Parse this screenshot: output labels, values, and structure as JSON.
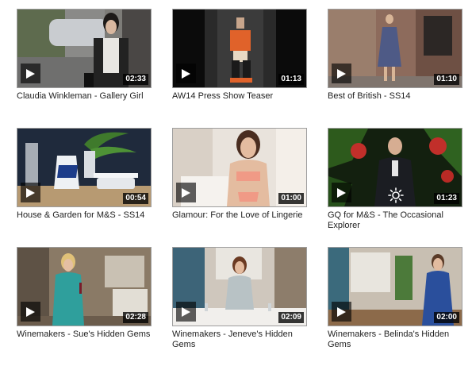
{
  "videos": [
    {
      "title": "Claudia Winkleman - Gallery Girl",
      "duration": "02:33"
    },
    {
      "title": "AW14 Press Show Teaser",
      "duration": "01:13"
    },
    {
      "title": "Best of British - SS14",
      "duration": "01:10"
    },
    {
      "title": "House & Garden for M&S - SS14",
      "duration": "00:54"
    },
    {
      "title": "Glamour: For the Love of Lingerie",
      "duration": "01:00"
    },
    {
      "title": "GQ for M&S - The Occasional Explorer",
      "duration": "01:23"
    },
    {
      "title": "Winemakers - Sue's Hidden Gems",
      "duration": "02:28"
    },
    {
      "title": "Winemakers - Jeneve's Hidden Gems",
      "duration": "02:09"
    },
    {
      "title": "Winemakers - Belinda's Hidden Gems",
      "duration": "02:00"
    }
  ],
  "icons": {
    "play": "play-icon",
    "settings": "settings-sun-icon"
  }
}
